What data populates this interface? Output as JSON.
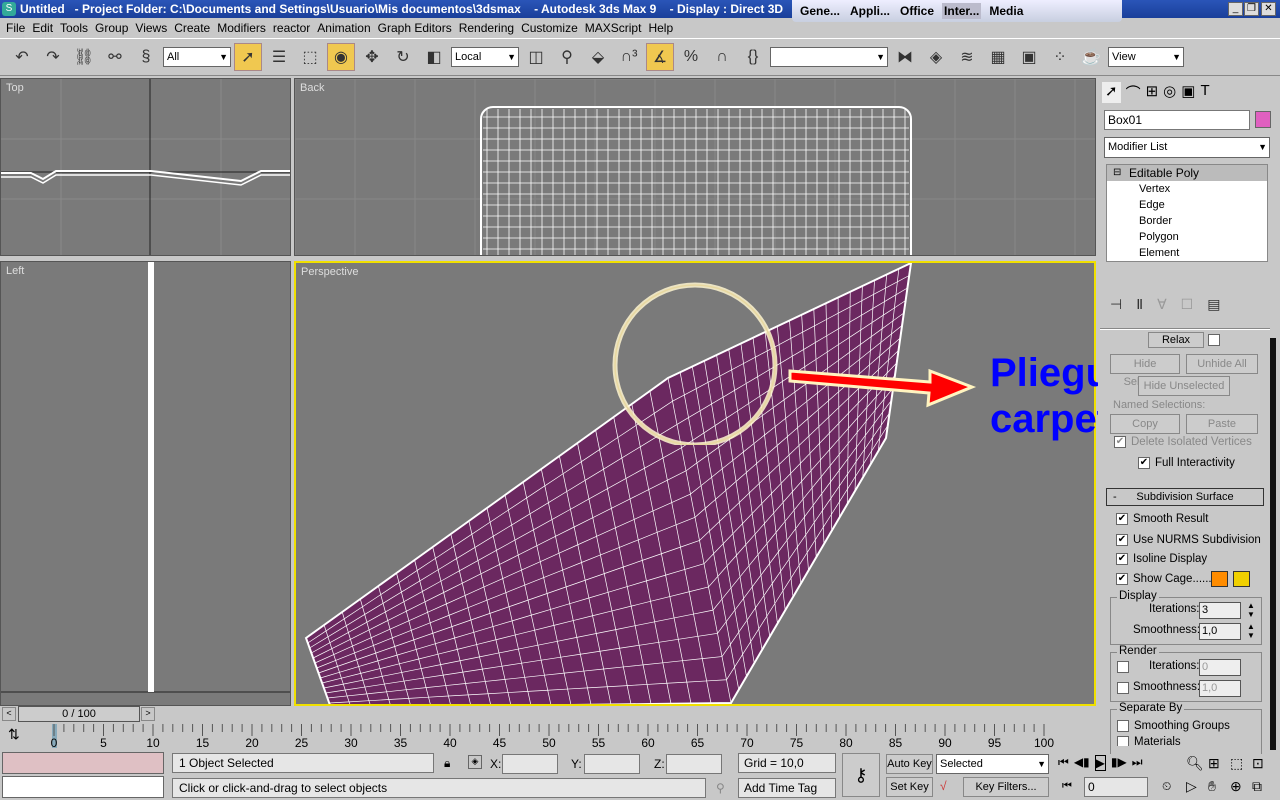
{
  "titlebar": {
    "title": "Untitled   - Project Folder: C:\\Documents and Settings\\Usuario\\Mis documentos\\3dsmax    - Autodesk 3ds Max 9    - Display : Direct 3D",
    "tabs": [
      "Gene...",
      "Appli...",
      "Office",
      "Inter...",
      "Media"
    ],
    "active_tab": "Inter..."
  },
  "menu": [
    "File",
    "Edit",
    "Tools",
    "Group",
    "Views",
    "Create",
    "Modifiers",
    "reactor",
    "Animation",
    "Graph Editors",
    "Rendering",
    "Customize",
    "MAXScript",
    "Help"
  ],
  "toolbar": {
    "selection_filter": "All",
    "coord_system": "Local",
    "view_dropdown": "View",
    "named_selection": ""
  },
  "viewports": {
    "top": "Top",
    "back": "Back",
    "left": "Left",
    "perspective": "Perspective"
  },
  "annotation": {
    "line1": "Pliegue de la",
    "line2": "carpeta",
    "color": "#0000ff",
    "arrow_color": "#ff0000"
  },
  "command_panel": {
    "object_name": "Box01",
    "object_color": "#e060c0",
    "modifier_list": "Modifier List",
    "stack": [
      "Editable Poly",
      "Vertex",
      "Edge",
      "Border",
      "Polygon",
      "Element"
    ],
    "relax": "Relax",
    "hide_selected": "Hide Selected",
    "unhide_all": "Unhide All",
    "hide_unselected": "Hide Unselected",
    "named_selections": "Named Selections:",
    "copy": "Copy",
    "paste": "Paste",
    "delete_isolated": "Delete Isolated Vertices",
    "full_interactivity": "Full Interactivity",
    "subdivision_title": "Subdivision Surface",
    "smooth_result": "Smooth Result",
    "use_nurms": "Use NURMS Subdivision",
    "isoline": "Isoline Display",
    "show_cage": "Show Cage......",
    "cage_colors": [
      "#ff8c00",
      "#f0d000"
    ],
    "display_label": "Display",
    "iterations_label": "Iterations:",
    "smoothness_label": "Smoothness:",
    "display_iterations": "3",
    "display_smoothness": "1,0",
    "render_label": "Render",
    "render_iterations": "0",
    "render_smoothness": "1,0",
    "separate_by": "Separate By",
    "smoothing_groups": "Smoothing Groups",
    "materials": "Materials"
  },
  "timeline": {
    "frame": "0 / 100",
    "ticks": [
      "0",
      "5",
      "10",
      "15",
      "20",
      "25",
      "30",
      "35",
      "40",
      "45",
      "50",
      "55",
      "60",
      "65",
      "70",
      "75",
      "80",
      "85",
      "90",
      "95",
      "100"
    ]
  },
  "status": {
    "selected": "1 Object Selected",
    "prompt": "Click or click-and-drag to select objects",
    "x_label": "X:",
    "y_label": "Y:",
    "z_label": "Z:",
    "grid": "Grid = 10,0",
    "add_time_tag": "Add Time Tag",
    "auto_key": "Auto Key",
    "set_key": "Set Key",
    "key_mode": "Selected",
    "key_filters": "Key Filters...",
    "current_frame": "0"
  }
}
